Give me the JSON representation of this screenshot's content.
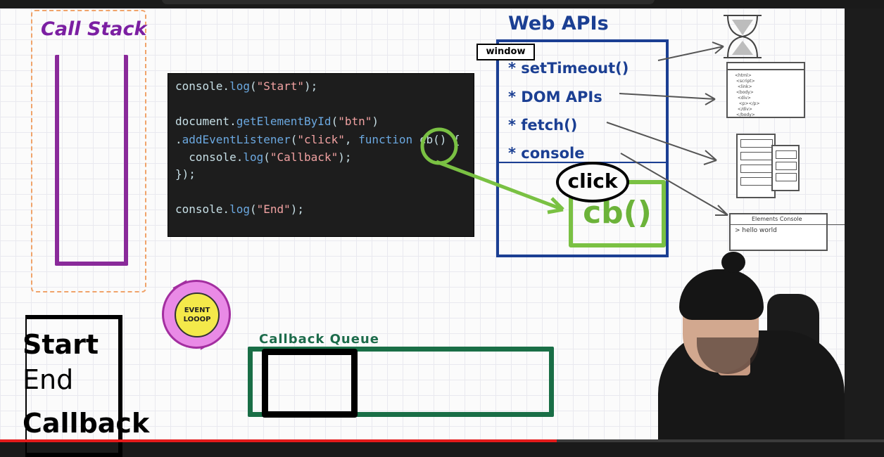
{
  "call_stack": {
    "title": "Call Stack"
  },
  "code": {
    "line1": [
      {
        "t": "console.",
        "c": "plain"
      },
      {
        "t": "log",
        "c": "fn"
      },
      {
        "t": "(",
        "c": "plain"
      },
      {
        "t": "\"Start\"",
        "c": "str"
      },
      {
        "t": ");",
        "c": "plain"
      }
    ],
    "line2": [
      {
        "t": "document.",
        "c": "plain"
      },
      {
        "t": "getElementById",
        "c": "fn"
      },
      {
        "t": "(",
        "c": "plain"
      },
      {
        "t": "\"btn\"",
        "c": "str"
      },
      {
        "t": ")",
        "c": "plain"
      }
    ],
    "line3": [
      {
        "t": ".",
        "c": "plain"
      },
      {
        "t": "addEventListener",
        "c": "fn"
      },
      {
        "t": "(",
        "c": "plain"
      },
      {
        "t": "\"click\"",
        "c": "str"
      },
      {
        "t": ", ",
        "c": "plain"
      },
      {
        "t": "function",
        "c": "fn"
      },
      {
        "t": " cb() {",
        "c": "plain"
      }
    ],
    "line4": [
      {
        "t": "  console.",
        "c": "plain"
      },
      {
        "t": "log",
        "c": "fn"
      },
      {
        "t": "(",
        "c": "plain"
      },
      {
        "t": "\"Callback\"",
        "c": "str"
      },
      {
        "t": ");",
        "c": "plain"
      }
    ],
    "line5": [
      {
        "t": "});",
        "c": "plain"
      }
    ],
    "line6": [
      {
        "t": "console.",
        "c": "plain"
      },
      {
        "t": "log",
        "c": "fn"
      },
      {
        "t": "(",
        "c": "plain"
      },
      {
        "t": "\"End\"",
        "c": "str"
      },
      {
        "t": ");",
        "c": "plain"
      }
    ]
  },
  "web_apis": {
    "title": "Web APIs",
    "window_label": "window",
    "items": [
      "* setTimeout()",
      "* DOM APIs",
      "* fetch()",
      "* console"
    ],
    "click_label": "click",
    "cb_label": "cb()"
  },
  "event_loop": {
    "line1": "EVENT",
    "line2": "LOOOP"
  },
  "output": {
    "lines": [
      "Start",
      "End",
      "Callback"
    ]
  },
  "callback_queue": {
    "title": "Callback Queue"
  },
  "console_icon": {
    "tabs": "Elements  Console",
    "output": "> hello world"
  },
  "colors": {
    "purple": "#8a2a9a",
    "navy": "#1b3f93",
    "green": "#7ac143",
    "queue_green": "#196e46",
    "progress_red": "#e21b1b"
  },
  "icons": [
    "hourglass-icon",
    "document-icon",
    "server-icon",
    "console-icon"
  ],
  "video_progress": 0.63
}
